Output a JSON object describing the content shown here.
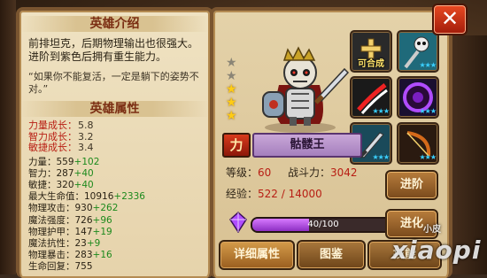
{
  "hero_intro": {
    "title": "英雄介绍",
    "description": "前排坦克，后期物理输出也很强大。进阶到紫色后拥有重生能力。",
    "quote": "“如果你不能复活，一定是躺下的姿势不对。”"
  },
  "hero_attributes": {
    "title": "英雄属性",
    "growth": [
      {
        "label": "力量成长：",
        "value": "5.8"
      },
      {
        "label": "智力成长：",
        "value": "3.2"
      },
      {
        "label": "敏捷成长：",
        "value": "3.4"
      }
    ],
    "stats": [
      {
        "label": "力量：",
        "value": "559",
        "bonus": "+102"
      },
      {
        "label": "智力：",
        "value": "287",
        "bonus": "+40"
      },
      {
        "label": "敏捷：",
        "value": "320",
        "bonus": "+40"
      },
      {
        "label": "最大生命值：",
        "value": "10916",
        "bonus": "+2336"
      },
      {
        "label": "物理攻击：",
        "value": "930",
        "bonus": "+262"
      },
      {
        "label": "魔法强度：",
        "value": "726",
        "bonus": "+96"
      },
      {
        "label": "物理护甲：",
        "value": "147",
        "bonus": "+19"
      },
      {
        "label": "魔法抗性：",
        "value": "23",
        "bonus": "+9"
      },
      {
        "label": "物理暴击：",
        "value": "283",
        "bonus": "+16"
      },
      {
        "label": "生命回复：",
        "value": "755",
        "bonus": ""
      }
    ]
  },
  "hero": {
    "name": "骷髅王",
    "power_badge": "力",
    "stars_total": 5,
    "stars_lit": 3
  },
  "info": {
    "level_label": "等级：",
    "level_value": "60",
    "power_label": "战斗力：",
    "power_value": "3042",
    "exp_label": "经验：",
    "exp_value": "522 / 14000"
  },
  "equipment": [
    {
      "icon": "plus-icon",
      "caption": "可合成",
      "stars": ""
    },
    {
      "icon": "skull-staff-icon",
      "caption": "",
      "stars": "★★★"
    },
    {
      "icon": "claw-slash-icon",
      "caption": "",
      "stars": "★★★"
    },
    {
      "icon": "dark-orb-icon",
      "caption": "",
      "stars": "★★★"
    },
    {
      "icon": "sword-icon",
      "caption": "",
      "stars": "★★★"
    },
    {
      "icon": "bow-icon",
      "caption": "",
      "stars": "★★★"
    }
  ],
  "buttons": {
    "advance": "进阶",
    "evolve": "进化"
  },
  "soul_stone": {
    "text": "40/100",
    "current": 40,
    "max": 100
  },
  "tabs": [
    "详细属性",
    "图鉴",
    "技能"
  ],
  "close_label": "✕",
  "watermark": {
    "small": "小皮",
    "big": "xiaopi"
  },
  "colors": {
    "accent_red": "#b81e14",
    "bonus_green": "#1d8a1d",
    "name_purple": "#a57fbd",
    "star_gold": "#ffcc14"
  }
}
